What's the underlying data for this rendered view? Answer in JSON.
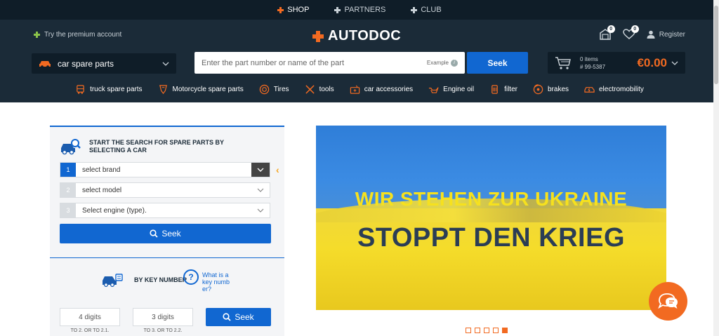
{
  "topnav": {
    "items": [
      {
        "label": "SHOP",
        "active": true
      },
      {
        "label": "PARTNERS",
        "active": false
      },
      {
        "label": "CLUB",
        "active": false
      }
    ]
  },
  "header": {
    "premium_label": "Try the premium account",
    "logo_text": "AUTODOC",
    "garage_count": "0",
    "wishlist_count": "0",
    "register_label": "Register",
    "category_select": "car spare parts",
    "search_placeholder": "Enter the part number or name of the part",
    "example_label": "Example",
    "seek_label": "Seek",
    "cart": {
      "items": "0 items",
      "id": "# 99-5387",
      "price": "€0.00"
    }
  },
  "categories": [
    {
      "label": "truck spare parts",
      "icon": "truck-icon"
    },
    {
      "label": "Motorcycle spare parts",
      "icon": "motorcycle-icon"
    },
    {
      "label": "Tires",
      "icon": "tire-icon"
    },
    {
      "label": "tools",
      "icon": "tools-icon"
    },
    {
      "label": "car accessories",
      "icon": "car-accessories-icon"
    },
    {
      "label": "Engine oil",
      "icon": "oil-can-icon"
    },
    {
      "label": "filter",
      "icon": "filter-icon"
    },
    {
      "label": "brakes",
      "icon": "brake-disc-icon"
    },
    {
      "label": "electromobility",
      "icon": "electric-car-icon"
    }
  ],
  "car_search": {
    "title": "START THE SEARCH FOR SPARE PARTS BY SELECTING A CAR",
    "steps": [
      {
        "num": "1",
        "label": "select brand"
      },
      {
        "num": "2",
        "label": "select model"
      },
      {
        "num": "3",
        "label": "Select engine (type)."
      }
    ],
    "seek_label": "Seek"
  },
  "key_number": {
    "title": "BY KEY NUMBER",
    "help_q": "?",
    "help_link": "What is a key number?",
    "input1_placeholder": "4 digits",
    "input1_hint": "TO 2. OR TO 2.1.",
    "input2_placeholder": "3 digits",
    "input2_hint": "TO 3. OR TO 2.2.",
    "seek_label": "Seek"
  },
  "banner": {
    "line1": "WIR STEHEN ZUR UKRAINE",
    "line2": "STOPPT DEN KRIEG",
    "slides": 5,
    "active_slide": 5
  },
  "colors": {
    "accent": "#f26a21",
    "primary": "#1167d1",
    "header_bg": "#1b2b38"
  }
}
